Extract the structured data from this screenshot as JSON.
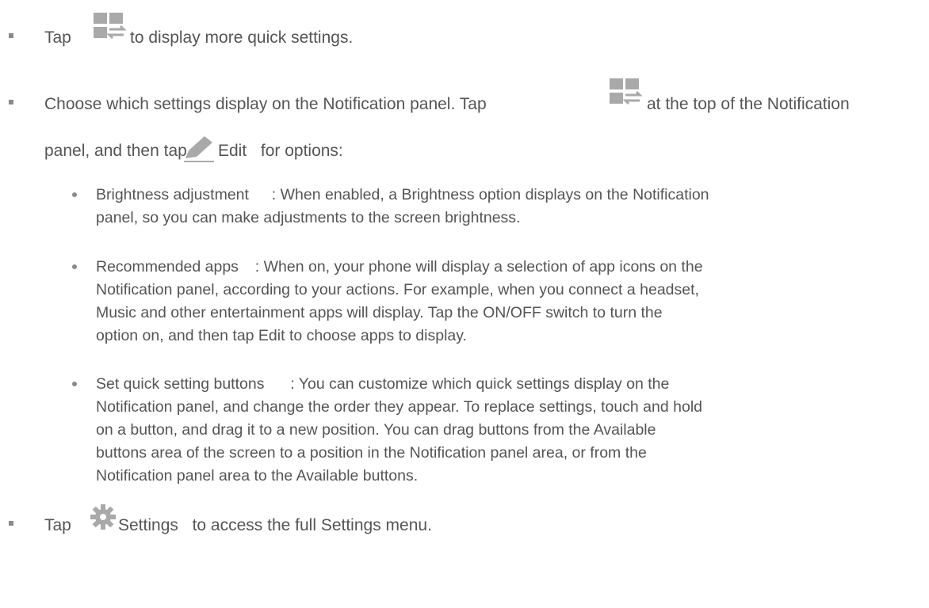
{
  "items": [
    {
      "pre": "Tap",
      "icon": "quick-settings-toggle-icon",
      "post": "to display more quick settings."
    },
    {
      "line1_pre": "Choose which settings display on the Notification panel. Tap",
      "icon": "quick-settings-toggle-icon",
      "line1_post": "at the top of the Notification",
      "line2_pre": "panel, and then tap",
      "edit_icon": "pencil-icon",
      "line2_edit": "Edit",
      "line2_post": "for options:",
      "subitems": [
        {
          "term": "Brightness adjustment",
          "lines": [
            ": When enabled, a Brightness option displays on the Notification",
            "panel, so you can make adjustments to the screen brightness."
          ]
        },
        {
          "term": "Recommended apps",
          "lines": [
            ": When on, your phone will display a selection of app icons on the",
            "Notification panel, according to your actions. For example, when you connect a headset,",
            "Music and other entertainment apps will display. Tap the ON/OFF switch to turn the",
            "option on, and then tap Edit to choose apps to display."
          ]
        },
        {
          "term": "Set quick setting buttons",
          "lines": [
            ": You can customize which quick settings display on the",
            "Notification panel, and change the order they appear. To replace settings, touch and hold",
            "on a button, and drag it to a new position. You can drag buttons from the Available",
            "buttons area of the screen to a position in the Notification panel area, or from the",
            "Notification panel area to the Available buttons."
          ]
        }
      ]
    },
    {
      "pre": "Tap",
      "icon": "gear-icon",
      "settings": "Settings",
      "post": "to access the full Settings menu."
    }
  ]
}
